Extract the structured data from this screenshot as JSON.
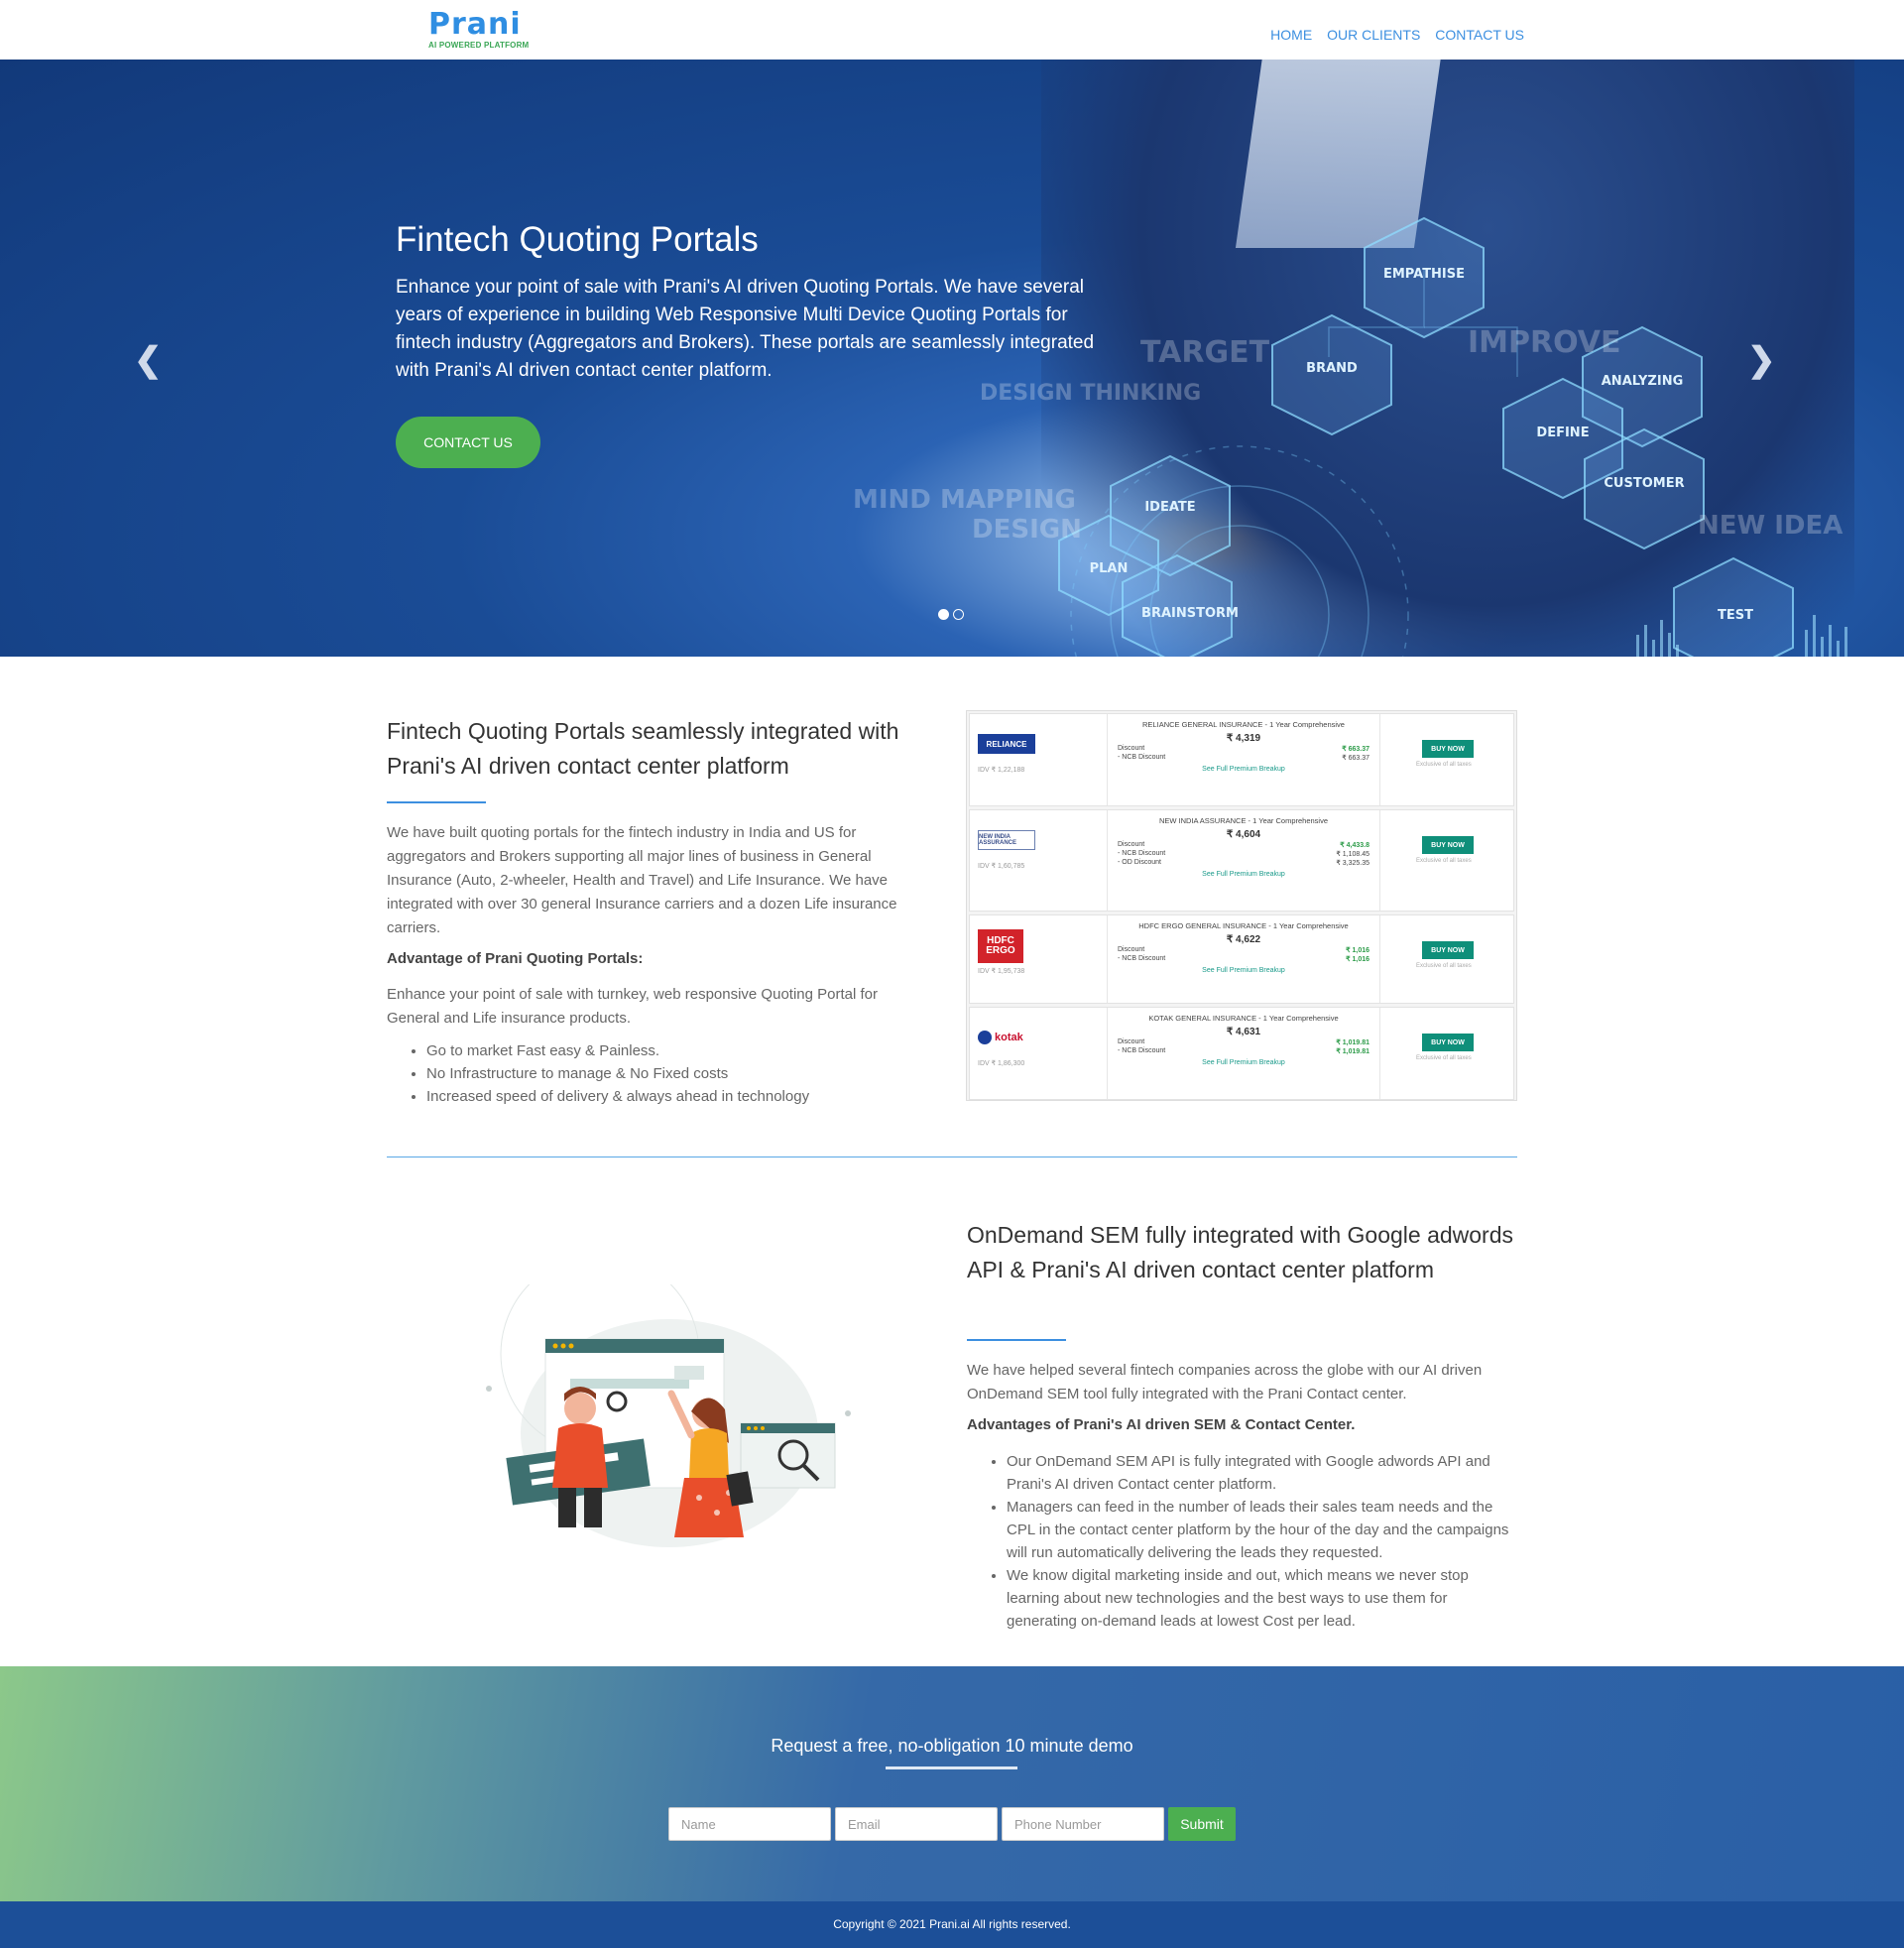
{
  "header": {
    "logo": "Prani",
    "logo_tagline": "AI POWERED PLATFORM",
    "nav": [
      "HOME",
      "OUR CLIENTS",
      "CONTACT US"
    ]
  },
  "hero": {
    "title": "Fintech Quoting Portals",
    "text": "Enhance your point of sale with Prani's AI driven Quoting Portals. We have several years of experience in building Web Responsive Multi Device Quoting Portals for fintech industry (Aggregators and Brokers). These portals are seamlessly integrated with Prani's AI driven contact center platform.",
    "button": "CONTACT US",
    "hex_labels": [
      "EMPATHISE",
      "BRAND",
      "ANALYZING",
      "DEFINE",
      "CUSTOMER",
      "IDEATE",
      "PLAN",
      "BRAINSTORM",
      "TEST"
    ],
    "bg_words": [
      "TARGET",
      "IMPROVE",
      "DESIGN THINKING",
      "MIND MAPPING",
      "DESIGN",
      "NEW IDEA"
    ],
    "slides": 2,
    "active_slide": 1
  },
  "section1": {
    "heading": "Fintech Quoting Portals seamlessly integrated with Prani's AI driven contact center platform",
    "paragraph": "We have built quoting portals for the fintech industry in India and US for aggregators and Brokers supporting all major lines of business in General Insurance (Auto, 2-wheeler, Health and Travel) and Life Insurance. We have integrated with over 30 general Insurance carriers and a dozen Life insurance carriers.",
    "subheading": "Advantage of Prani Quoting Portals:",
    "paragraph2": "Enhance your point of sale with turnkey, web responsive Quoting Portal for General and Life insurance products.",
    "bullets": [
      "Go to market Fast easy & Painless.",
      "No Infrastructure to manage & No Fixed costs",
      "Increased speed of delivery & always ahead in technology"
    ]
  },
  "quotes": [
    {
      "logo": "RELIANCE",
      "logo_color": "#1b3f9a",
      "idv": "IDV ₹ 1,22,188",
      "title": "RELIANCE GENERAL INSURANCE - 1 Year Comprehensive",
      "price": "₹ 4,319",
      "lines": [
        [
          "Discount",
          "₹ 663.37"
        ],
        [
          "- NCB Discount",
          "₹ 663.37"
        ]
      ],
      "link": "See Full Premium Breakup",
      "buy": "BUY NOW",
      "note": "Exclusive of all taxes"
    },
    {
      "logo": "NEW INDIA ASSURANCE",
      "logo_color": "#6a7fb0",
      "idv": "IDV ₹ 1,60,785",
      "title": "NEW INDIA ASSURANCE - 1 Year Comprehensive",
      "price": "₹ 4,604",
      "lines": [
        [
          "Discount",
          "₹ 4,433.8"
        ],
        [
          "- NCB Discount",
          "₹ 1,108.45"
        ],
        [
          "- OD Discount",
          "₹ 3,325.35"
        ]
      ],
      "link": "See Full Premium Breakup",
      "buy": "BUY NOW",
      "note": "Exclusive of all taxes"
    },
    {
      "logo": "HDFC ERGO",
      "logo_color": "#d2232a",
      "idv": "IDV ₹ 1,95,738",
      "title": "HDFC ERGO GENERAL INSURANCE - 1 Year Comprehensive",
      "price": "₹ 4,622",
      "lines": [
        [
          "Discount",
          "₹ 1,016"
        ],
        [
          "- NCB Discount",
          "₹ 1,016"
        ]
      ],
      "link": "See Full Premium Breakup",
      "buy": "BUY NOW",
      "note": "Exclusive of all taxes"
    },
    {
      "logo": "kotak",
      "logo_color": "#c8102e",
      "idv": "IDV ₹ 1,86,300",
      "title": "KOTAK GENERAL INSURANCE - 1 Year Comprehensive",
      "price": "₹ 4,631",
      "lines": [
        [
          "Discount",
          "₹ 1,019.81"
        ],
        [
          "- NCB Discount",
          "₹ 1,019.81"
        ]
      ],
      "link": "See Full Premium Breakup",
      "buy": "BUY NOW",
      "note": "Exclusive of all taxes"
    }
  ],
  "section2": {
    "heading": "OnDemand SEM fully integrated with Google adwords API & Prani's AI driven contact center platform",
    "paragraph": "We have helped several fintech companies across the globe with our AI driven OnDemand SEM tool fully integrated with the Prani Contact center.",
    "subheading": "Advantages of Prani's AI driven SEM & Contact Center.",
    "bullets": [
      "Our OnDemand SEM API is fully integrated with Google adwords API and Prani's AI driven Contact center platform.",
      "Managers can feed in the number of leads their sales team needs and the CPL in the contact center platform by the hour of the day and the campaigns will run automatically delivering the leads they requested.",
      "We know digital marketing inside and out, which means we never stop learning about new technologies and the best ways to use them for generating on-demand leads at lowest Cost per lead."
    ]
  },
  "demo": {
    "title": "Request a free, no-obligation 10 minute demo",
    "name_placeholder": "Name",
    "email_placeholder": "Email",
    "phone_placeholder": "Phone Number",
    "submit": "Submit"
  },
  "footer": {
    "copyright": "Copyright © 2021 Prani.ai All rights reserved."
  }
}
